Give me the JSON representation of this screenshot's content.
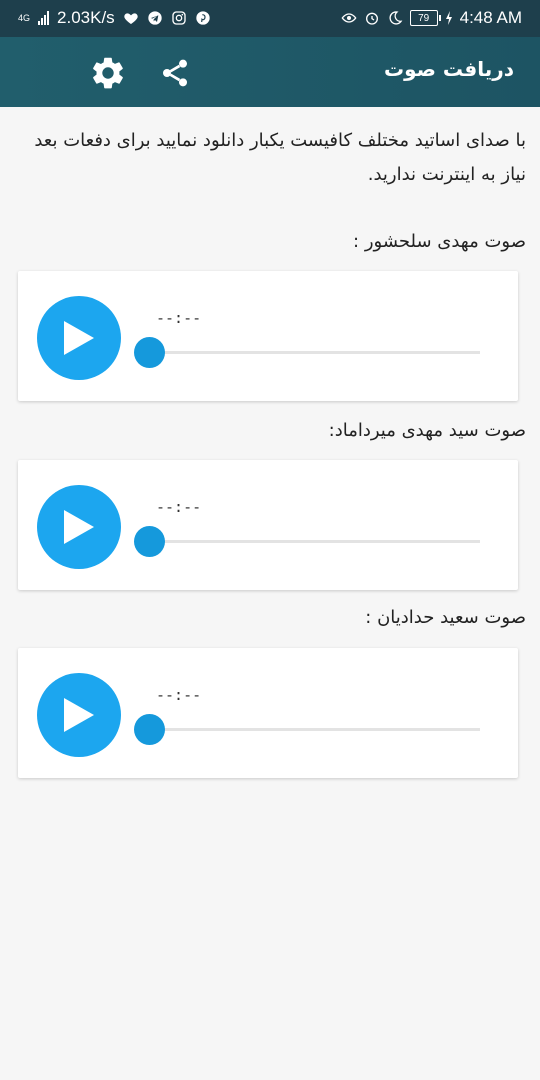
{
  "status_bar": {
    "network_type": "4G",
    "speed": "2.03K/s",
    "battery": "79",
    "time": "4:48 AM"
  },
  "app_bar": {
    "title": "دریافت صوت",
    "share_icon": "share-icon",
    "settings_icon": "gear-icon"
  },
  "intro_text": "با صدای اساتید مختلف کافیست یکبار دانلود نمایید برای دفعات بعد نیاز به اینترنت ندارید.",
  "players": [
    {
      "label": "صوت مهدی سلحشور :",
      "time": "--:--",
      "progress": 0
    },
    {
      "label": "صوت سید مهدی میرداماد:",
      "time": "--:--",
      "progress": 0
    },
    {
      "label": "صوت سعید حدادیان :",
      "time": "--:--",
      "progress": 0
    }
  ],
  "colors": {
    "status_bar": "#1e3f4c",
    "app_bar": "#215e6c",
    "play_button": "#1ca6ef",
    "seek_thumb": "#1599dc"
  }
}
